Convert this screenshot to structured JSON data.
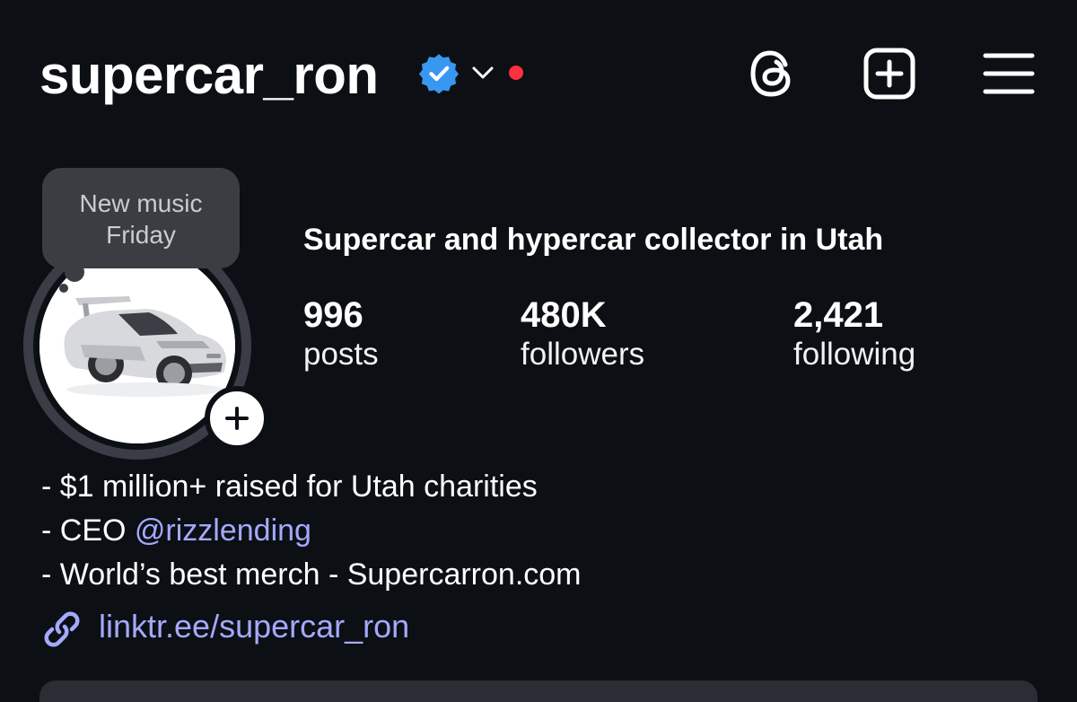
{
  "header": {
    "username": "supercar_ron",
    "icons": {
      "verified": "verified-badge-icon",
      "account_switcher": "chevron-down-icon",
      "notification": "red-dot",
      "threads": "threads-icon",
      "create": "add-square-icon",
      "menu": "hamburger-menu-icon"
    }
  },
  "note": {
    "line1": "New music",
    "line2": "Friday"
  },
  "profile": {
    "full_name": "Supercar and hypercar collector in Utah",
    "stats": [
      {
        "value": "996",
        "label": "posts"
      },
      {
        "value": "480K",
        "label": "followers"
      },
      {
        "value": "2,421",
        "label": "following"
      }
    ]
  },
  "bio": {
    "line1": "- $1 million+ raised for Utah charities",
    "line2_prefix": "- CEO ",
    "line2_mention": "@rizzlending",
    "line3": "- World’s best merch - Supercarron.com",
    "link": "linktr.ee/supercar_ron"
  },
  "colors": {
    "background": "#0c0f14",
    "verified_blue": "#3897f0",
    "notification_red": "#ff3040",
    "link_color": "#a4a9ff"
  }
}
